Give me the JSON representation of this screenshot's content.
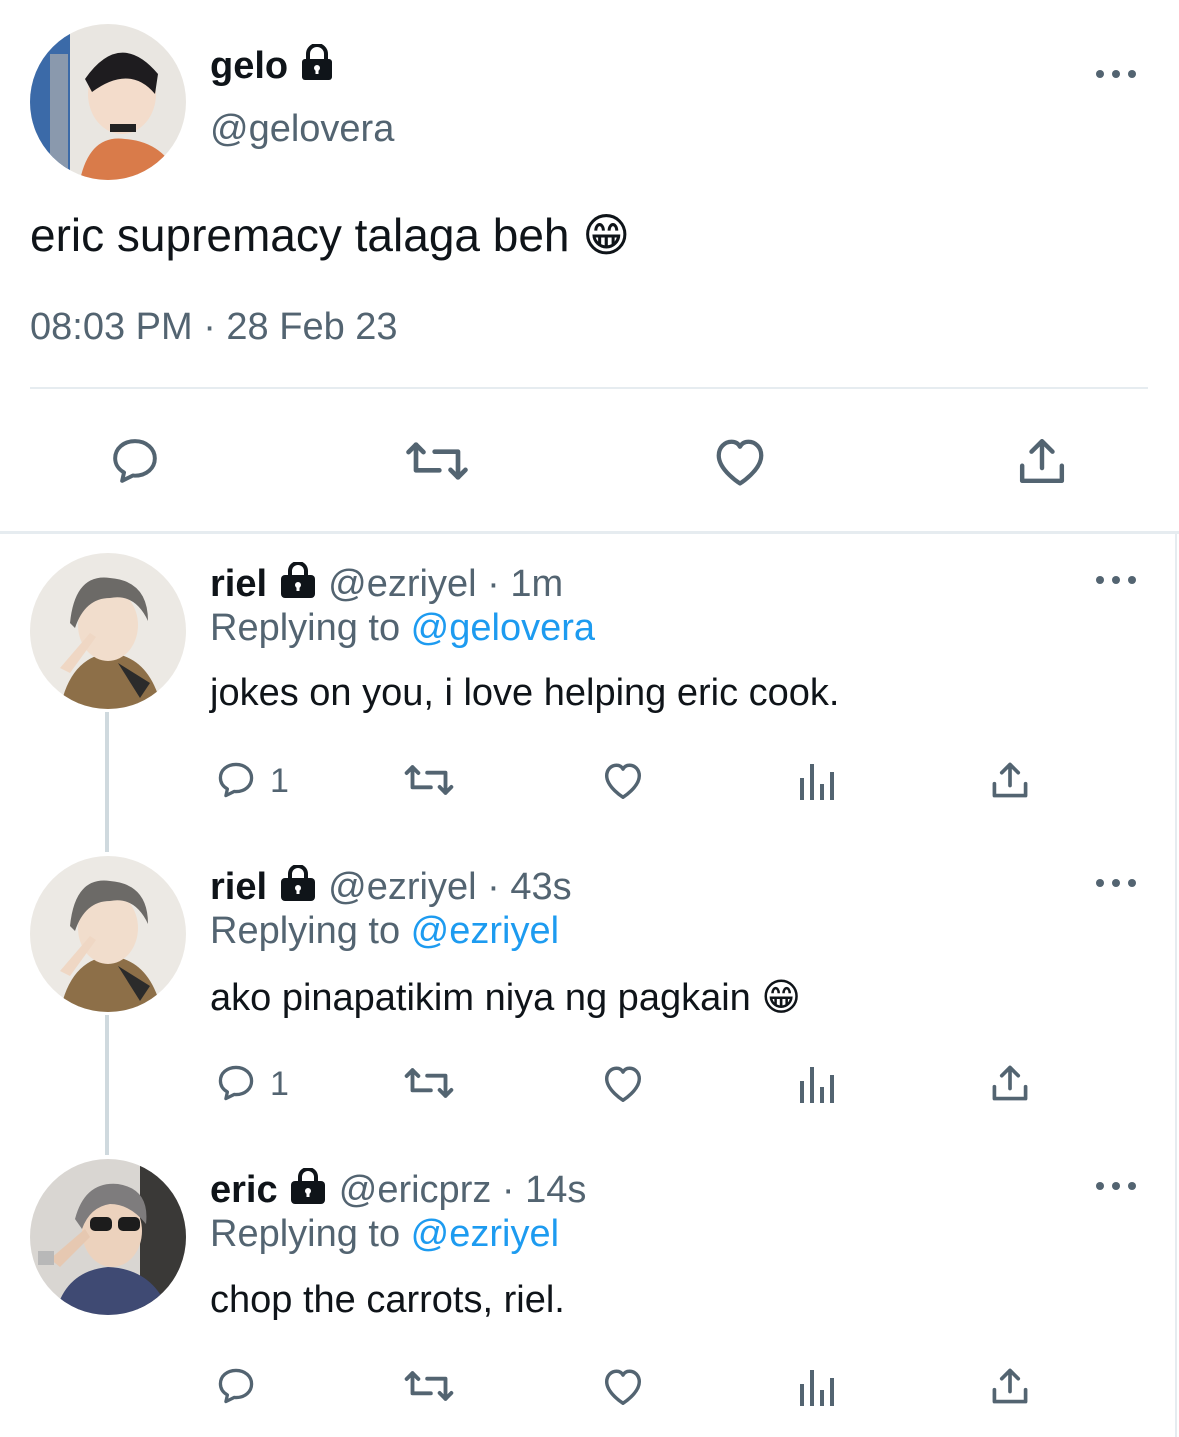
{
  "main_tweet": {
    "display_name": "gelo",
    "handle": "@gelovera",
    "text": "eric supremacy talaga beh",
    "emoji": "😁",
    "timestamp": "08:03 PM · 28 Feb 23",
    "icons": [
      "reply-icon",
      "retweet-icon",
      "like-icon",
      "share-icon"
    ]
  },
  "replies": [
    {
      "display_name": "riel",
      "handle": "@ezriyel",
      "time": " · 1m",
      "replying_label": "Replying to ",
      "replying_to": "@gelovera",
      "text": "jokes on you, i love helping eric cook.",
      "emoji": "",
      "reply_count": "1"
    },
    {
      "display_name": "riel",
      "handle": "@ezriyel",
      "time": " · 43s",
      "replying_label": "Replying to ",
      "replying_to": "@ezriyel",
      "text": "ako pinapatikim niya ng pagkain",
      "emoji": "😁",
      "reply_count": "1"
    },
    {
      "display_name": "eric",
      "handle": "@ericprz",
      "time": " · 14s",
      "replying_label": "Replying to ",
      "replying_to": "@ezriyel",
      "text": "chop the carrots, riel.",
      "emoji": "",
      "reply_count": ""
    }
  ],
  "colors": {
    "text": "#0f1419",
    "secondary": "#536471",
    "link": "#1d9bf0",
    "divider": "#e6ecf0"
  }
}
